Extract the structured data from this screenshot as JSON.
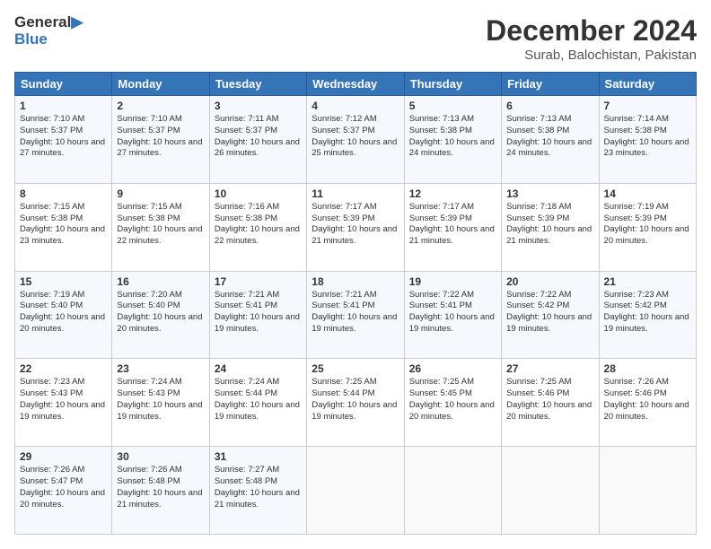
{
  "logo": {
    "line1": "General",
    "line2": "Blue"
  },
  "title": "December 2024",
  "subtitle": "Surab, Balochistan, Pakistan",
  "days_of_week": [
    "Sunday",
    "Monday",
    "Tuesday",
    "Wednesday",
    "Thursday",
    "Friday",
    "Saturday"
  ],
  "weeks": [
    [
      {
        "day": 1,
        "sunrise": "7:10 AM",
        "sunset": "5:37 PM",
        "daylight": "10 hours and 27 minutes."
      },
      {
        "day": 2,
        "sunrise": "7:10 AM",
        "sunset": "5:37 PM",
        "daylight": "10 hours and 27 minutes."
      },
      {
        "day": 3,
        "sunrise": "7:11 AM",
        "sunset": "5:37 PM",
        "daylight": "10 hours and 26 minutes."
      },
      {
        "day": 4,
        "sunrise": "7:12 AM",
        "sunset": "5:37 PM",
        "daylight": "10 hours and 25 minutes."
      },
      {
        "day": 5,
        "sunrise": "7:13 AM",
        "sunset": "5:38 PM",
        "daylight": "10 hours and 24 minutes."
      },
      {
        "day": 6,
        "sunrise": "7:13 AM",
        "sunset": "5:38 PM",
        "daylight": "10 hours and 24 minutes."
      },
      {
        "day": 7,
        "sunrise": "7:14 AM",
        "sunset": "5:38 PM",
        "daylight": "10 hours and 23 minutes."
      }
    ],
    [
      {
        "day": 8,
        "sunrise": "7:15 AM",
        "sunset": "5:38 PM",
        "daylight": "10 hours and 23 minutes."
      },
      {
        "day": 9,
        "sunrise": "7:15 AM",
        "sunset": "5:38 PM",
        "daylight": "10 hours and 22 minutes."
      },
      {
        "day": 10,
        "sunrise": "7:16 AM",
        "sunset": "5:38 PM",
        "daylight": "10 hours and 22 minutes."
      },
      {
        "day": 11,
        "sunrise": "7:17 AM",
        "sunset": "5:39 PM",
        "daylight": "10 hours and 21 minutes."
      },
      {
        "day": 12,
        "sunrise": "7:17 AM",
        "sunset": "5:39 PM",
        "daylight": "10 hours and 21 minutes."
      },
      {
        "day": 13,
        "sunrise": "7:18 AM",
        "sunset": "5:39 PM",
        "daylight": "10 hours and 21 minutes."
      },
      {
        "day": 14,
        "sunrise": "7:19 AM",
        "sunset": "5:39 PM",
        "daylight": "10 hours and 20 minutes."
      }
    ],
    [
      {
        "day": 15,
        "sunrise": "7:19 AM",
        "sunset": "5:40 PM",
        "daylight": "10 hours and 20 minutes."
      },
      {
        "day": 16,
        "sunrise": "7:20 AM",
        "sunset": "5:40 PM",
        "daylight": "10 hours and 20 minutes."
      },
      {
        "day": 17,
        "sunrise": "7:21 AM",
        "sunset": "5:41 PM",
        "daylight": "10 hours and 19 minutes."
      },
      {
        "day": 18,
        "sunrise": "7:21 AM",
        "sunset": "5:41 PM",
        "daylight": "10 hours and 19 minutes."
      },
      {
        "day": 19,
        "sunrise": "7:22 AM",
        "sunset": "5:41 PM",
        "daylight": "10 hours and 19 minutes."
      },
      {
        "day": 20,
        "sunrise": "7:22 AM",
        "sunset": "5:42 PM",
        "daylight": "10 hours and 19 minutes."
      },
      {
        "day": 21,
        "sunrise": "7:23 AM",
        "sunset": "5:42 PM",
        "daylight": "10 hours and 19 minutes."
      }
    ],
    [
      {
        "day": 22,
        "sunrise": "7:23 AM",
        "sunset": "5:43 PM",
        "daylight": "10 hours and 19 minutes."
      },
      {
        "day": 23,
        "sunrise": "7:24 AM",
        "sunset": "5:43 PM",
        "daylight": "10 hours and 19 minutes."
      },
      {
        "day": 24,
        "sunrise": "7:24 AM",
        "sunset": "5:44 PM",
        "daylight": "10 hours and 19 minutes."
      },
      {
        "day": 25,
        "sunrise": "7:25 AM",
        "sunset": "5:44 PM",
        "daylight": "10 hours and 19 minutes."
      },
      {
        "day": 26,
        "sunrise": "7:25 AM",
        "sunset": "5:45 PM",
        "daylight": "10 hours and 20 minutes."
      },
      {
        "day": 27,
        "sunrise": "7:25 AM",
        "sunset": "5:46 PM",
        "daylight": "10 hours and 20 minutes."
      },
      {
        "day": 28,
        "sunrise": "7:26 AM",
        "sunset": "5:46 PM",
        "daylight": "10 hours and 20 minutes."
      }
    ],
    [
      {
        "day": 29,
        "sunrise": "7:26 AM",
        "sunset": "5:47 PM",
        "daylight": "10 hours and 20 minutes."
      },
      {
        "day": 30,
        "sunrise": "7:26 AM",
        "sunset": "5:48 PM",
        "daylight": "10 hours and 21 minutes."
      },
      {
        "day": 31,
        "sunrise": "7:27 AM",
        "sunset": "5:48 PM",
        "daylight": "10 hours and 21 minutes."
      },
      null,
      null,
      null,
      null
    ]
  ]
}
